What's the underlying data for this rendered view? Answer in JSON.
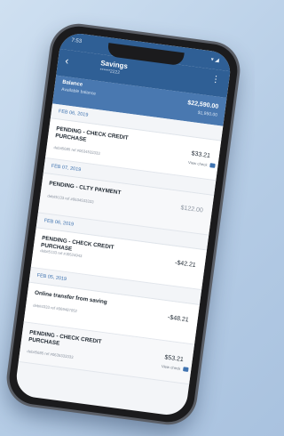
{
  "status": {
    "time": "7:53",
    "signal": "▾ ◢"
  },
  "header": {
    "title": "Savings",
    "subtitle": "******2222",
    "back_icon": "‹",
    "more_icon": "⋮"
  },
  "balance": {
    "label": "Balance",
    "label_sub": "Available balance",
    "amount": "$22,590.00",
    "amount_sub": "$1,950.00"
  },
  "dates": [
    "FEB 06, 2019",
    "FEB 07, 2019",
    "FEB 06, 2019",
    "FEB 05, 2019"
  ],
  "transactions": [
    {
      "desc": "PENDING - CHECK CREDIT PURCHASE",
      "ref": "debit5685 ref #0634533333",
      "amount": "$33.21",
      "tag": "View check"
    },
    {
      "desc": "PENDING - CLTY PAYMENT",
      "ref": "debit5133 ref #0634533333",
      "amount": "$122.00",
      "tag": ""
    },
    {
      "desc": "PENDING - CHECK CREDIT PURCHASE",
      "ref": "debit5133 ref #J0524943",
      "amount": "-$42.21",
      "tag": ""
    },
    {
      "desc": "Online transfer from saving",
      "ref": "debit4333 ref #069487052",
      "amount": "-$48.21",
      "tag": ""
    },
    {
      "desc": "PENDING - CHECK CREDIT PURCHASE",
      "ref": "debit5685 ref #0635333333",
      "amount": "$53.21",
      "tag": "View check"
    }
  ]
}
